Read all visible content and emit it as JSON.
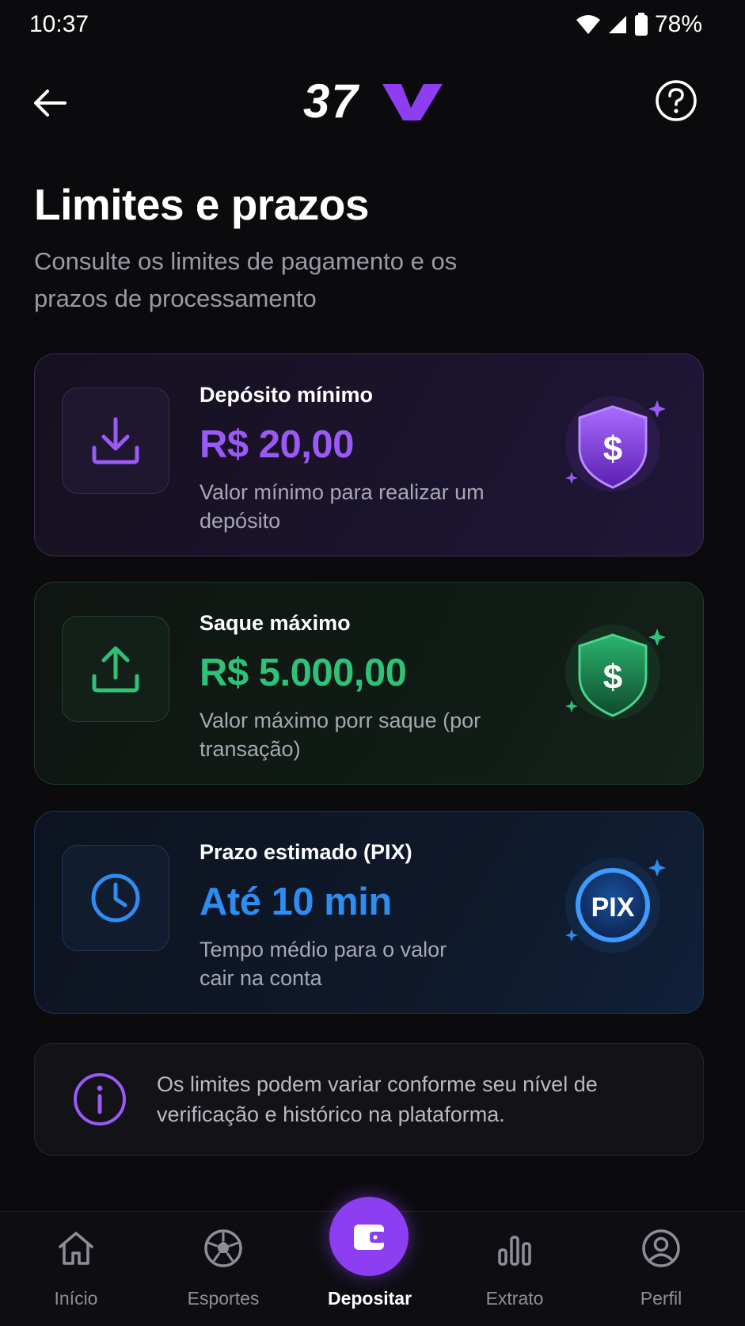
{
  "status_bar": {
    "time": "10:37",
    "battery": "78%"
  },
  "app_bar": {
    "logo_text": "37V",
    "back_icon": "arrow-left-icon",
    "help_icon": "question-circle-icon"
  },
  "page": {
    "title": "Limites e prazos",
    "subtitle": "Consulte os limites de pagamento e os prazos de processamento"
  },
  "cards": [
    {
      "label": "Depósito mínimo",
      "value": "R$ 20,00",
      "description": "Valor mínimo para realizar um depósito",
      "icon": "download-icon",
      "badge": "shield-dollar-icon",
      "accent": "#9b59f5"
    },
    {
      "label": "Saque máximo",
      "value": "R$ 5.000,00",
      "description": "Valor máximo porr saque (por transação)",
      "icon": "upload-icon",
      "badge": "shield-dollar-icon",
      "accent": "#2fc178"
    },
    {
      "label": "Prazo estimado (PIX)",
      "value": "Até 10 min",
      "description": "Tempo médio para o valor cair na conta",
      "icon": "clock-icon",
      "badge": "pix-icon",
      "badge_text": "PIX",
      "accent": "#2f8cf0"
    }
  ],
  "info": {
    "text": "Os limites podem variar conforme seu nível de verificação e histórico na plataforma.",
    "icon": "info-icon"
  },
  "bottom_nav": {
    "active": "Depositar",
    "items": [
      {
        "label": "Início",
        "icon": "home-icon"
      },
      {
        "label": "Esportes",
        "icon": "soccer-ball-icon"
      },
      {
        "label": "Depositar",
        "icon": "wallet-icon"
      },
      {
        "label": "Extrato",
        "icon": "bar-chart-icon"
      },
      {
        "label": "Perfil",
        "icon": "user-circle-icon"
      }
    ]
  }
}
